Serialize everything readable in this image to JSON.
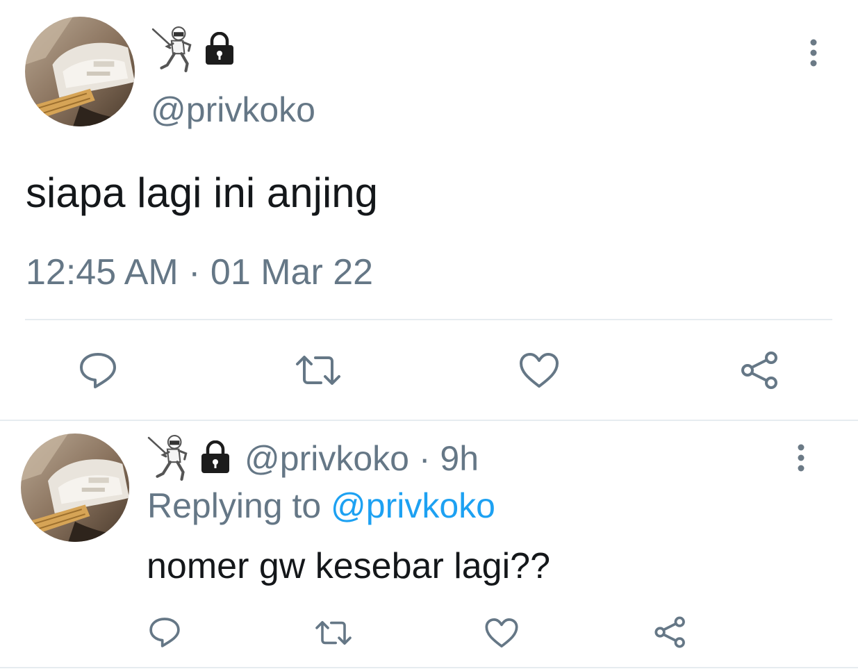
{
  "main_tweet": {
    "avatar": "guitar-photo-avatar",
    "emojis": [
      "fencer-emoji",
      "lock-icon"
    ],
    "handle": "@privkoko",
    "text": "siapa lagi ini anjing",
    "timestamp": "12:45 AM · 01 Mar 22",
    "actions": [
      "reply-icon",
      "retweet-icon",
      "like-icon",
      "share-icon"
    ],
    "menu_icon": "more-vertical-icon"
  },
  "reply_tweet": {
    "avatar": "guitar-photo-avatar",
    "emojis": [
      "fencer-emoji",
      "lock-icon"
    ],
    "handle": "@privkoko",
    "separator": " · ",
    "age": "9h",
    "replying_prefix": "Replying to ",
    "replying_to": "@privkoko",
    "text": "nomer gw kesebar lagi??",
    "actions": [
      "reply-icon",
      "retweet-icon",
      "like-icon",
      "share-icon"
    ],
    "menu_icon": "more-vertical-icon"
  },
  "colors": {
    "secondary_text": "#657786",
    "primary_text": "#14171a",
    "link": "#1da1f2",
    "icon": "#657786",
    "divider": "#e6ecf0"
  }
}
